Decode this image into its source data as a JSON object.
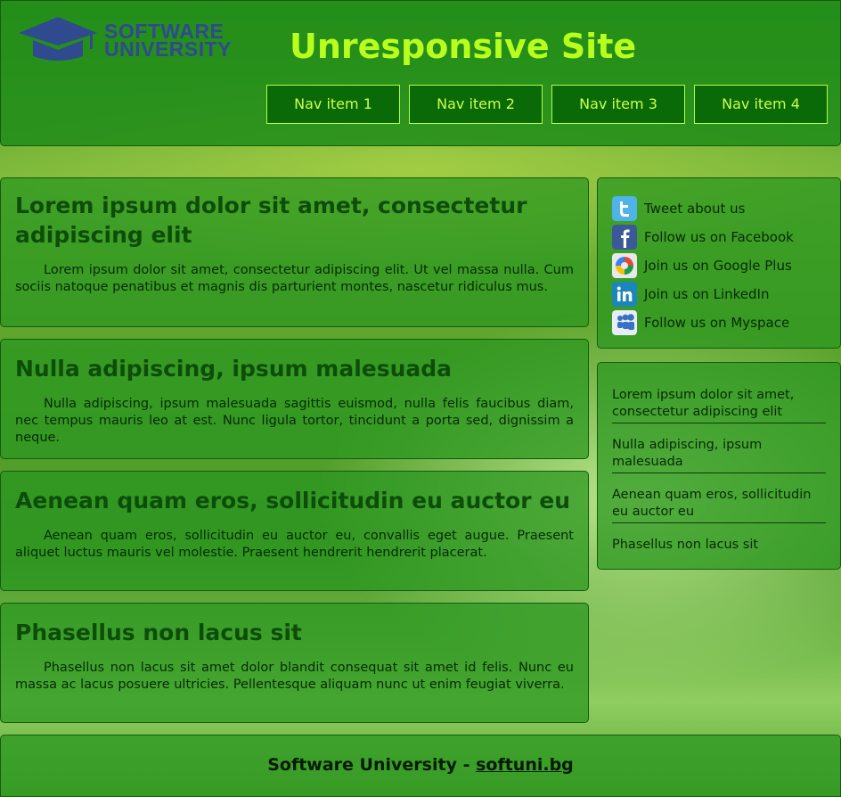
{
  "header": {
    "logo": {
      "line1": "SOFTWARE",
      "line2": "UNIVERSITY"
    },
    "title": "Unresponsive Site",
    "nav": [
      "Nav item 1",
      "Nav item 2",
      "Nav item 3",
      "Nav item 4"
    ]
  },
  "articles": [
    {
      "title": "Lorem ipsum dolor sit amet, consectetur adipiscing elit",
      "body": "Lorem ipsum dolor sit amet, consectetur adipiscing elit. Ut vel massa nulla. Cum sociis natoque penatibus et magnis dis parturient montes, nascetur ridiculus mus."
    },
    {
      "title": "Nulla adipiscing, ipsum malesuada",
      "body": "Nulla adipiscing, ipsum malesuada sagittis euismod, nulla felis faucibus diam, nec tempus mauris leo at est. Nunc ligula tortor, tincidunt a porta sed, dignissim a neque."
    },
    {
      "title": "Aenean quam eros, sollicitudin eu auctor eu",
      "body": "Aenean quam eros, sollicitudin eu auctor eu, convallis eget augue. Praesent aliquet luctus mauris vel molestie. Praesent hendrerit hendrerit placerat."
    },
    {
      "title": "Phasellus non lacus sit",
      "body": "Phasellus non lacus sit amet dolor blandit consequat sit amet id felis. Nunc eu massa ac lacus posuere ultricies. Pellentesque aliquam nunc ut enim feugiat viverra."
    }
  ],
  "social": [
    {
      "label": "Tweet about us",
      "icon": "twitter-icon",
      "color": "#4fb3e8"
    },
    {
      "label": "Follow us on Facebook",
      "icon": "facebook-icon",
      "color": "#3b5998"
    },
    {
      "label": "Join us on Google Plus",
      "icon": "google-plus-icon",
      "color": "#dd4b39"
    },
    {
      "label": "Join us on LinkedIn",
      "icon": "linkedin-icon",
      "color": "#1b86bc"
    },
    {
      "label": "Follow us on Myspace",
      "icon": "myspace-icon",
      "color": "#3a6fc4"
    }
  ],
  "links": [
    "Lorem ipsum dolor sit amet, consectetur adipiscing elit",
    "Nulla adipiscing, ipsum malesuada",
    "Aenean quam eros, sollicitudin eu auctor eu",
    "Phasellus non lacus sit"
  ],
  "footer": {
    "text": "Software University - ",
    "link": "softuni.bg"
  },
  "colors": {
    "title": "#b8ff1e",
    "nav_bg": "#0a6a08",
    "nav_text": "#ccff4a",
    "logo": "#2f4a8e"
  }
}
